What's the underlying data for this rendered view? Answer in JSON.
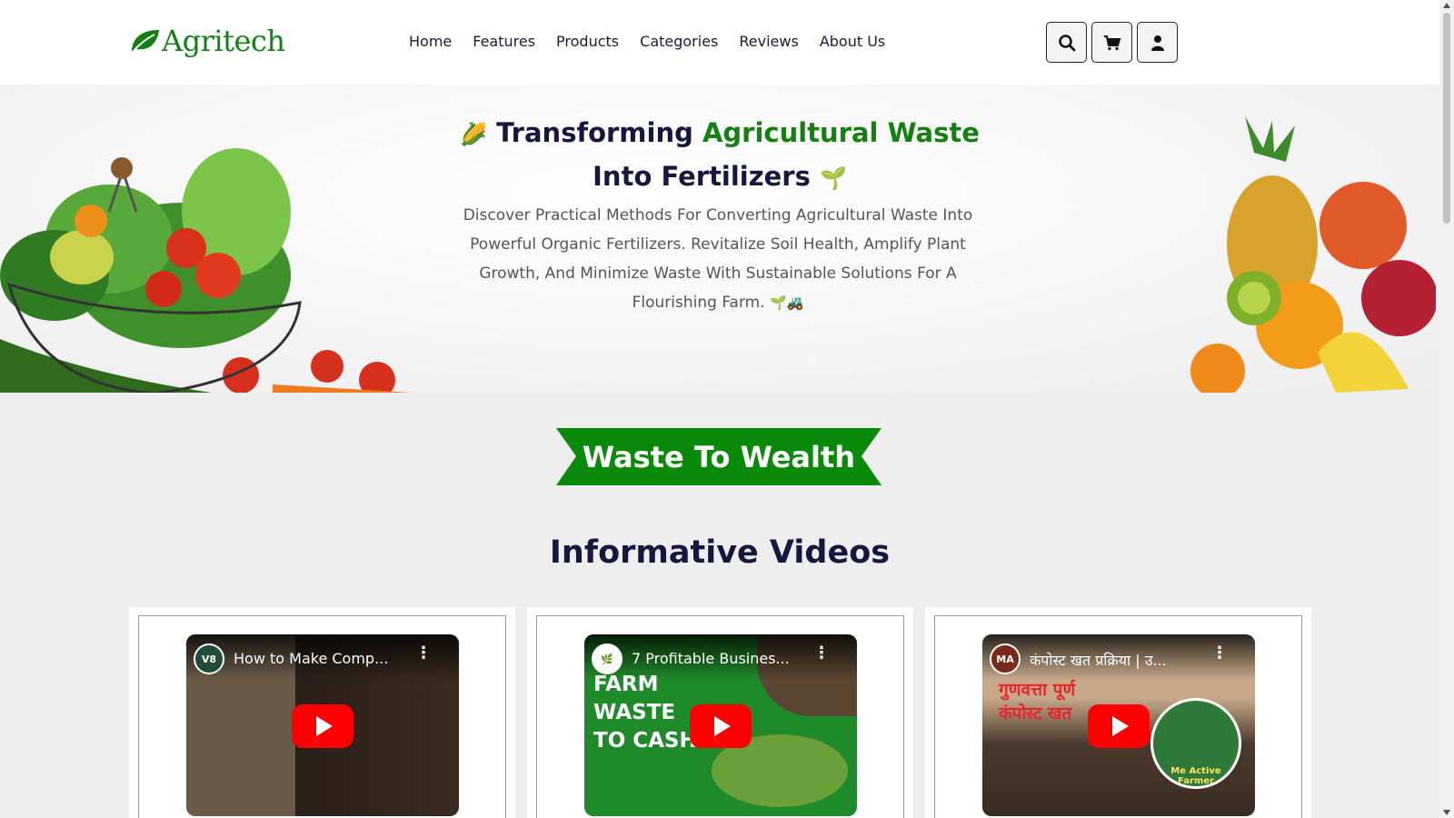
{
  "brand": {
    "name": "Agritech",
    "color": "#128012"
  },
  "nav": [
    "Home",
    "Features",
    "Products",
    "Categories",
    "Reviews",
    "About Us"
  ],
  "header_icons": [
    "search-icon",
    "cart-icon",
    "user-icon"
  ],
  "hero": {
    "title_part1": "Transforming ",
    "title_accent": "Agricultural Waste",
    "title_part2": "Into Fertilizers",
    "title_icon_left": "🌽",
    "title_icon_right": "🌱",
    "description": "Discover Practical Methods For Converting Agricultural Waste Into Powerful Organic Fertilizers. Revitalize Soil Health, Amplify Plant Growth, And Minimize Waste With Sustainable Solutions For A Flourishing Farm.",
    "description_emoji": "🌱🚜"
  },
  "banner": {
    "label": "Waste To Wealth",
    "color": "#0a8a0a"
  },
  "section_title": "Informative Videos",
  "videos": [
    {
      "title": "How to Make Comp...",
      "channel": "V8",
      "thumb_color": "#4a3a2c"
    },
    {
      "title": "7 Profitable Busines...",
      "channel": "🌿",
      "thumb_color": "#1f8a2a"
    },
    {
      "title": "कंपोस्ट खत प्रक्रिया | उ...",
      "channel": "MA",
      "thumb_color": "#5a4632"
    }
  ],
  "video_overlay_text": {
    "video2": [
      "FARM",
      "WASTE",
      "TO CASH"
    ],
    "video3": [
      "गुणवत्ता पूर्ण",
      "कंपोस्ट खत",
      "Me Active Farmer"
    ]
  }
}
